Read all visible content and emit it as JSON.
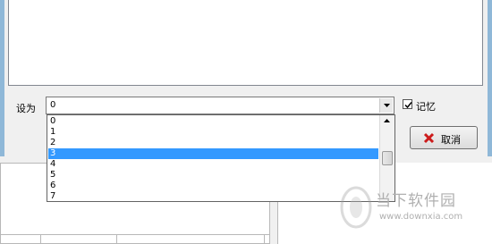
{
  "form": {
    "set_label": "设为",
    "combo_value": "0",
    "remember_label": "记忆",
    "remember_checked": true
  },
  "buttons": {
    "cancel_label": "取消"
  },
  "dropdown": {
    "options": [
      "0",
      "1",
      "2",
      "3",
      "4",
      "5",
      "6",
      "7"
    ],
    "selected_index": 3
  },
  "watermark": {
    "name": "当下软件园",
    "url": "www.downxia.com"
  },
  "icons": {
    "combo": "chevron-down-icon",
    "checkbox": "checkmark-icon",
    "cancel": "red-x-icon",
    "scroll": "arrow-up-icon"
  }
}
